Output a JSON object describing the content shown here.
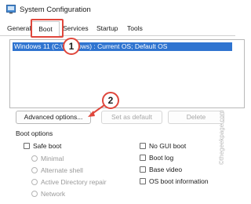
{
  "window": {
    "title": "System Configuration"
  },
  "tabs": [
    {
      "label": "General"
    },
    {
      "label": "Boot"
    },
    {
      "label": "Services"
    },
    {
      "label": "Startup"
    },
    {
      "label": "Tools"
    }
  ],
  "os_list": {
    "items": [
      {
        "label": "Windows 11 (C:\\Windows) : Current OS; Default OS",
        "selected": true
      }
    ]
  },
  "buttons": {
    "advanced": "Advanced options...",
    "set_default": "Set as default",
    "delete": "Delete"
  },
  "boot_options": {
    "title": "Boot options",
    "safe_boot": "Safe boot",
    "minimal": "Minimal",
    "alternate_shell": "Alternate shell",
    "ad_repair": "Active Directory repair",
    "network": "Network",
    "no_gui_boot": "No GUI boot",
    "boot_log": "Boot log",
    "base_video": "Base video",
    "os_boot_information": "OS boot information"
  },
  "annotations": {
    "step1": "1",
    "step2": "2"
  },
  "watermark": "©thegeekpage.com",
  "colors": {
    "accent": "#2f74d0",
    "annotation": "#e0473c"
  }
}
